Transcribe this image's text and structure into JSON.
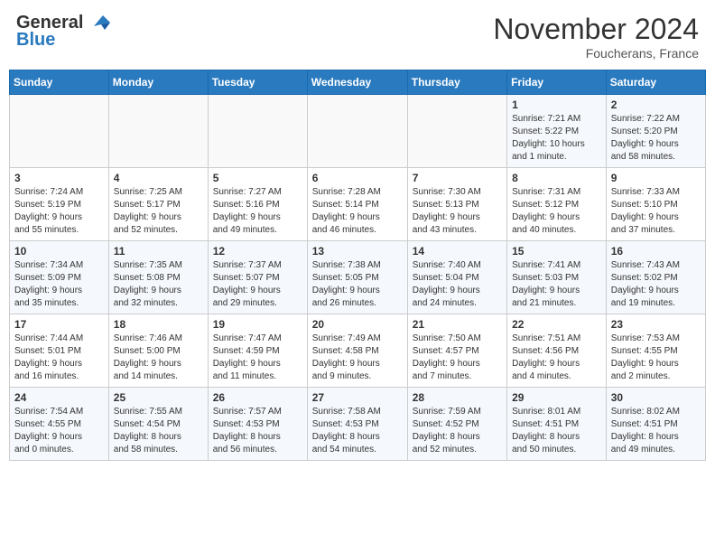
{
  "header": {
    "logo_general": "General",
    "logo_blue": "Blue",
    "month_title": "November 2024",
    "location": "Foucherans, France"
  },
  "weekdays": [
    "Sunday",
    "Monday",
    "Tuesday",
    "Wednesday",
    "Thursday",
    "Friday",
    "Saturday"
  ],
  "weeks": [
    [
      {
        "day": "",
        "info": ""
      },
      {
        "day": "",
        "info": ""
      },
      {
        "day": "",
        "info": ""
      },
      {
        "day": "",
        "info": ""
      },
      {
        "day": "",
        "info": ""
      },
      {
        "day": "1",
        "info": "Sunrise: 7:21 AM\nSunset: 5:22 PM\nDaylight: 10 hours\nand 1 minute."
      },
      {
        "day": "2",
        "info": "Sunrise: 7:22 AM\nSunset: 5:20 PM\nDaylight: 9 hours\nand 58 minutes."
      }
    ],
    [
      {
        "day": "3",
        "info": "Sunrise: 7:24 AM\nSunset: 5:19 PM\nDaylight: 9 hours\nand 55 minutes."
      },
      {
        "day": "4",
        "info": "Sunrise: 7:25 AM\nSunset: 5:17 PM\nDaylight: 9 hours\nand 52 minutes."
      },
      {
        "day": "5",
        "info": "Sunrise: 7:27 AM\nSunset: 5:16 PM\nDaylight: 9 hours\nand 49 minutes."
      },
      {
        "day": "6",
        "info": "Sunrise: 7:28 AM\nSunset: 5:14 PM\nDaylight: 9 hours\nand 46 minutes."
      },
      {
        "day": "7",
        "info": "Sunrise: 7:30 AM\nSunset: 5:13 PM\nDaylight: 9 hours\nand 43 minutes."
      },
      {
        "day": "8",
        "info": "Sunrise: 7:31 AM\nSunset: 5:12 PM\nDaylight: 9 hours\nand 40 minutes."
      },
      {
        "day": "9",
        "info": "Sunrise: 7:33 AM\nSunset: 5:10 PM\nDaylight: 9 hours\nand 37 minutes."
      }
    ],
    [
      {
        "day": "10",
        "info": "Sunrise: 7:34 AM\nSunset: 5:09 PM\nDaylight: 9 hours\nand 35 minutes."
      },
      {
        "day": "11",
        "info": "Sunrise: 7:35 AM\nSunset: 5:08 PM\nDaylight: 9 hours\nand 32 minutes."
      },
      {
        "day": "12",
        "info": "Sunrise: 7:37 AM\nSunset: 5:07 PM\nDaylight: 9 hours\nand 29 minutes."
      },
      {
        "day": "13",
        "info": "Sunrise: 7:38 AM\nSunset: 5:05 PM\nDaylight: 9 hours\nand 26 minutes."
      },
      {
        "day": "14",
        "info": "Sunrise: 7:40 AM\nSunset: 5:04 PM\nDaylight: 9 hours\nand 24 minutes."
      },
      {
        "day": "15",
        "info": "Sunrise: 7:41 AM\nSunset: 5:03 PM\nDaylight: 9 hours\nand 21 minutes."
      },
      {
        "day": "16",
        "info": "Sunrise: 7:43 AM\nSunset: 5:02 PM\nDaylight: 9 hours\nand 19 minutes."
      }
    ],
    [
      {
        "day": "17",
        "info": "Sunrise: 7:44 AM\nSunset: 5:01 PM\nDaylight: 9 hours\nand 16 minutes."
      },
      {
        "day": "18",
        "info": "Sunrise: 7:46 AM\nSunset: 5:00 PM\nDaylight: 9 hours\nand 14 minutes."
      },
      {
        "day": "19",
        "info": "Sunrise: 7:47 AM\nSunset: 4:59 PM\nDaylight: 9 hours\nand 11 minutes."
      },
      {
        "day": "20",
        "info": "Sunrise: 7:49 AM\nSunset: 4:58 PM\nDaylight: 9 hours\nand 9 minutes."
      },
      {
        "day": "21",
        "info": "Sunrise: 7:50 AM\nSunset: 4:57 PM\nDaylight: 9 hours\nand 7 minutes."
      },
      {
        "day": "22",
        "info": "Sunrise: 7:51 AM\nSunset: 4:56 PM\nDaylight: 9 hours\nand 4 minutes."
      },
      {
        "day": "23",
        "info": "Sunrise: 7:53 AM\nSunset: 4:55 PM\nDaylight: 9 hours\nand 2 minutes."
      }
    ],
    [
      {
        "day": "24",
        "info": "Sunrise: 7:54 AM\nSunset: 4:55 PM\nDaylight: 9 hours\nand 0 minutes."
      },
      {
        "day": "25",
        "info": "Sunrise: 7:55 AM\nSunset: 4:54 PM\nDaylight: 8 hours\nand 58 minutes."
      },
      {
        "day": "26",
        "info": "Sunrise: 7:57 AM\nSunset: 4:53 PM\nDaylight: 8 hours\nand 56 minutes."
      },
      {
        "day": "27",
        "info": "Sunrise: 7:58 AM\nSunset: 4:53 PM\nDaylight: 8 hours\nand 54 minutes."
      },
      {
        "day": "28",
        "info": "Sunrise: 7:59 AM\nSunset: 4:52 PM\nDaylight: 8 hours\nand 52 minutes."
      },
      {
        "day": "29",
        "info": "Sunrise: 8:01 AM\nSunset: 4:51 PM\nDaylight: 8 hours\nand 50 minutes."
      },
      {
        "day": "30",
        "info": "Sunrise: 8:02 AM\nSunset: 4:51 PM\nDaylight: 8 hours\nand 49 minutes."
      }
    ]
  ]
}
